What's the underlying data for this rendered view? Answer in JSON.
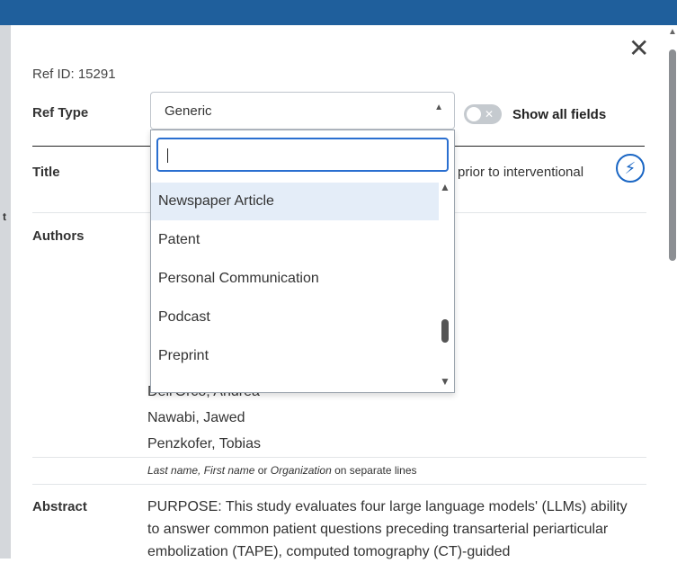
{
  "ref_id": "Ref ID: 15291",
  "labels": {
    "ref_type": "Ref Type",
    "title": "Title",
    "authors": "Authors",
    "abstract": "Abstract"
  },
  "ref_type_select": {
    "value": "Generic",
    "search_value": ""
  },
  "show_all_fields": {
    "label": "Show all fields",
    "checked": false
  },
  "title_value_visible": "prior to interventional",
  "dropdown_options": [
    "Newspaper Article",
    "Patent",
    "Personal Communication",
    "Podcast",
    "Preprint"
  ],
  "authors": [
    "Nawabi, Jawed",
    "Penzkofer, Tobias"
  ],
  "authors_partial": "Dell'Orco, Andrea",
  "authors_hint": {
    "part1": "Last name, First name",
    "part2": " or ",
    "part3": "Organization",
    "part4": " on separate lines"
  },
  "abstract_text": "PURPOSE: This study evaluates four large language models' (LLMs) ability to answer common patient questions preceding transarterial periarticular embolization (TAPE), computed tomography (CT)-guided",
  "colors": {
    "header": "#1f5f9c",
    "accent": "#1a66c4",
    "option_highlight": "#e4edf8"
  },
  "icons": [
    "close-icon",
    "caret-up-icon",
    "toggle-x-icon",
    "lightning-bolt-icon"
  ]
}
